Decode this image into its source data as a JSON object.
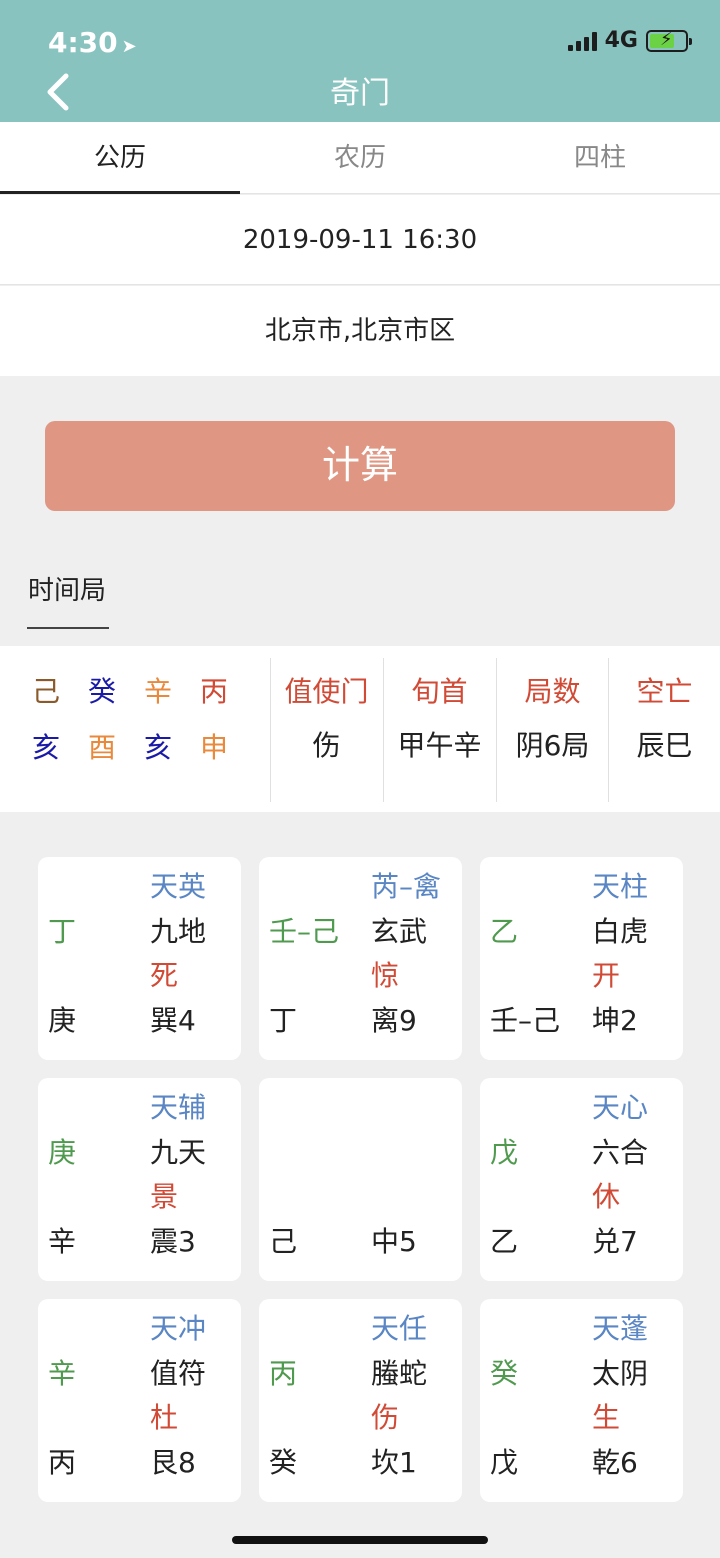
{
  "status": {
    "time": "4:30",
    "network": "4G"
  },
  "header": {
    "title": "奇门"
  },
  "tabs": [
    {
      "label": "公历"
    },
    {
      "label": "农历"
    },
    {
      "label": "四柱"
    }
  ],
  "form": {
    "datetime": "2019-09-11 16:30",
    "location": "北京市,北京市区",
    "calc_label": "计算"
  },
  "section": {
    "label": "时间局"
  },
  "pillars": {
    "stems": [
      {
        "char": "己",
        "color": "#8b5a2b"
      },
      {
        "char": "癸",
        "color": "#1a1aa8"
      },
      {
        "char": "辛",
        "color": "#e8893c"
      },
      {
        "char": "丙",
        "color": "#d14a35"
      }
    ],
    "branches": [
      {
        "char": "亥",
        "color": "#1a1aa8"
      },
      {
        "char": "酉",
        "color": "#e8893c"
      },
      {
        "char": "亥",
        "color": "#1a1aa8"
      },
      {
        "char": "申",
        "color": "#e8893c"
      }
    ]
  },
  "info": [
    {
      "label": "值使门",
      "value": "伤"
    },
    {
      "label": "旬首",
      "value": "甲午辛"
    },
    {
      "label": "局数",
      "value": "阴6局"
    },
    {
      "label": "空亡",
      "value": "辰巳"
    }
  ],
  "palaces": [
    {
      "star": "天英",
      "left": "丁",
      "deity": "九地",
      "door": "死",
      "bottom": "庚",
      "palace": "巽4"
    },
    {
      "star": "芮–禽",
      "left": "壬–己",
      "deity": "玄武",
      "door": "惊",
      "bottom": "丁",
      "palace": "离9"
    },
    {
      "star": "天柱",
      "left": "乙",
      "deity": "白虎",
      "door": "开",
      "bottom": "壬–己",
      "palace": "坤2"
    },
    {
      "star": "天辅",
      "left": "庚",
      "deity": "九天",
      "door": "景",
      "bottom": "辛",
      "palace": "震3"
    },
    {
      "star": "",
      "left": "",
      "deity": "",
      "door": "",
      "bottom": "己",
      "palace": "中5"
    },
    {
      "star": "天心",
      "left": "戊",
      "deity": "六合",
      "door": "休",
      "bottom": "乙",
      "palace": "兑7"
    },
    {
      "star": "天冲",
      "left": "辛",
      "deity": "值符",
      "door": "杜",
      "bottom": "丙",
      "palace": "艮8"
    },
    {
      "star": "天任",
      "left": "丙",
      "deity": "螣蛇",
      "door": "伤",
      "bottom": "癸",
      "palace": "坎1"
    },
    {
      "star": "天蓬",
      "left": "癸",
      "deity": "太阴",
      "door": "生",
      "bottom": "戊",
      "palace": "乾6"
    }
  ]
}
